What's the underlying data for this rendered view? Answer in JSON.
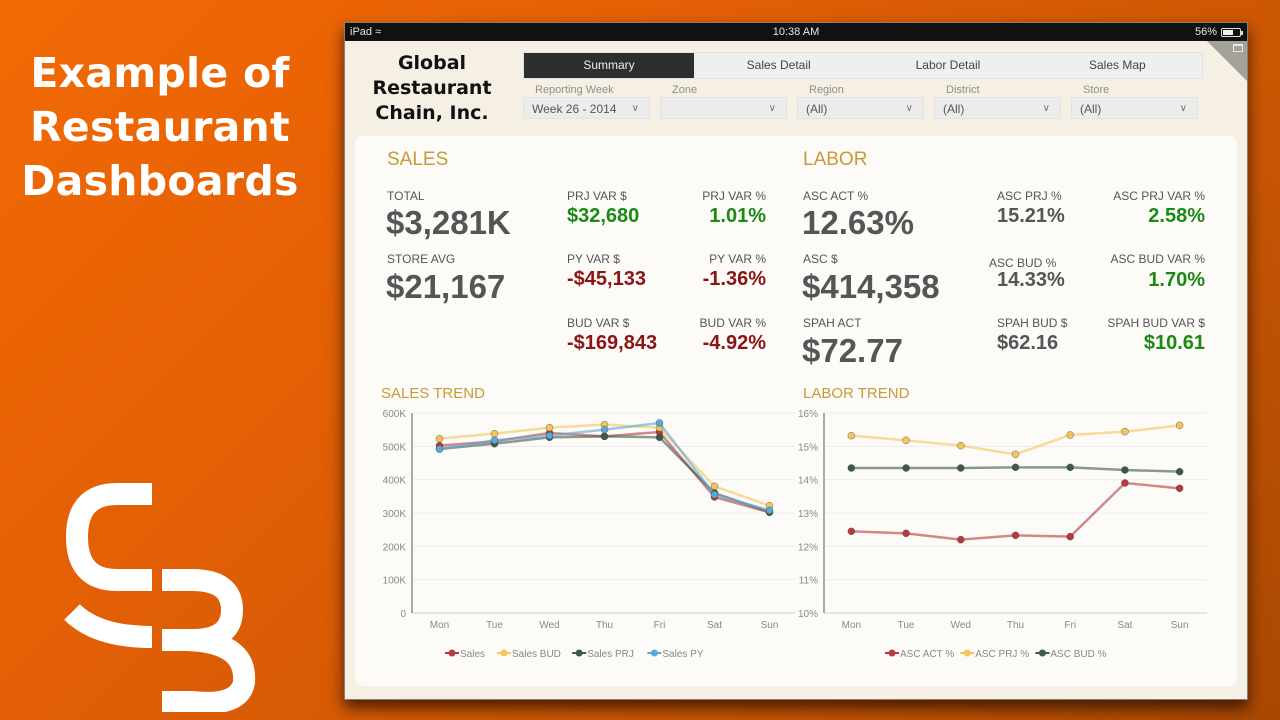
{
  "promo": {
    "title_lines": [
      "Example of",
      "Restaurant",
      "Dashboards"
    ],
    "logo": "sb-logo"
  },
  "statusbar": {
    "device": "iPad",
    "wifi_icon": "wifi-icon",
    "time": "10:38 AM",
    "battery": "56%",
    "battery_level": 0.56
  },
  "header": {
    "company_lines": [
      "Global",
      "Restaurant",
      "Chain, Inc."
    ],
    "tabs": [
      {
        "label": "Summary",
        "active": true
      },
      {
        "label": "Sales Detail",
        "active": false
      },
      {
        "label": "Labor Detail",
        "active": false
      },
      {
        "label": "Sales Map",
        "active": false
      }
    ],
    "filters": [
      {
        "label": "Reporting Week",
        "value": "Week 26 - 2014"
      },
      {
        "label": "Zone",
        "value": ""
      },
      {
        "label": "Region",
        "value": "(All)"
      },
      {
        "label": "District",
        "value": "(All)"
      },
      {
        "label": "Store",
        "value": "(All)"
      }
    ]
  },
  "sales": {
    "title": "SALES",
    "total": {
      "label": "TOTAL",
      "value": "$3,281K"
    },
    "store_avg": {
      "label": "STORE AVG",
      "value": "$21,167"
    },
    "prj_var_usd": {
      "label": "PRJ VAR $",
      "value": "$32,680"
    },
    "prj_var_pct": {
      "label": "PRJ VAR %",
      "value": "1.01%"
    },
    "py_var_usd": {
      "label": "PY VAR $",
      "value": "-$45,133"
    },
    "py_var_pct": {
      "label": "PY VAR %",
      "value": "-1.36%"
    },
    "bud_var_usd": {
      "label": "BUD VAR $",
      "value": "-$169,843"
    },
    "bud_var_pct": {
      "label": "BUD VAR %",
      "value": "-4.92%"
    }
  },
  "labor": {
    "title": "LABOR",
    "asc_act_pct": {
      "label": "ASC ACT %",
      "value": "12.63%"
    },
    "asc_usd": {
      "label": "ASC $",
      "value": "$414,358"
    },
    "spah_act": {
      "label": "SPAH ACT",
      "value": "$72.77"
    },
    "asc_prj_pct": {
      "label": "ASC PRJ %",
      "value": "15.21%"
    },
    "asc_bud_pct": {
      "label": "ASC BUD %",
      "value": "14.33%"
    },
    "spah_bud": {
      "label": "SPAH BUD $",
      "value": "$62.16"
    },
    "asc_prj_var_pct": {
      "label": "ASC PRJ VAR %",
      "value": "2.58%"
    },
    "asc_bud_var_pct": {
      "label": "ASC BUD VAR %",
      "value": "1.70%"
    },
    "spah_bud_var": {
      "label": "SPAH BUD VAR $",
      "value": "$10.61"
    }
  },
  "colors": {
    "accent": "#c99a3a",
    "positive": "#1b8a14",
    "negative": "#8b1414"
  },
  "chart_data": [
    {
      "type": "line",
      "title": "SALES TREND",
      "categories": [
        "Mon",
        "Tue",
        "Wed",
        "Thu",
        "Fri",
        "Sat",
        "Sun"
      ],
      "ylim": [
        0,
        600000
      ],
      "yticks": [
        0,
        100000,
        200000,
        300000,
        400000,
        500000,
        600000
      ],
      "ytick_labels": [
        "0",
        "100K",
        "200K",
        "300K",
        "400K",
        "500K",
        "600K"
      ],
      "grid": true,
      "legend": "bottom",
      "series": [
        {
          "name": "Sales",
          "color": "#b83a3a",
          "values": [
            502000,
            515000,
            540000,
            530000,
            543000,
            348000,
            302000
          ]
        },
        {
          "name": "Sales BUD",
          "color": "#f2c65a",
          "values": [
            523000,
            538000,
            556000,
            565000,
            556000,
            380000,
            322000
          ]
        },
        {
          "name": "Sales PRJ",
          "color": "#3d5a48",
          "values": [
            492000,
            508000,
            527000,
            530000,
            527000,
            360000,
            303000
          ]
        },
        {
          "name": "Sales PY",
          "color": "#5aa7d9",
          "values": [
            492000,
            518000,
            532000,
            550000,
            570000,
            355000,
            308000
          ]
        }
      ]
    },
    {
      "type": "line",
      "title": "LABOR TREND",
      "categories": [
        "Mon",
        "Tue",
        "Wed",
        "Thu",
        "Fri",
        "Sat",
        "Sun"
      ],
      "ylim": [
        10,
        16
      ],
      "yticks": [
        10,
        11,
        12,
        13,
        14,
        15,
        16
      ],
      "ytick_labels": [
        "10%",
        "11%",
        "12%",
        "13%",
        "14%",
        "15%",
        "16%"
      ],
      "grid": true,
      "legend": "bottom",
      "series": [
        {
          "name": "ASC ACT %",
          "color": "#b83a3a",
          "values": [
            12.45,
            12.39,
            12.2,
            12.33,
            12.29,
            13.9,
            13.74
          ]
        },
        {
          "name": "ASC PRJ %",
          "color": "#f2c65a",
          "values": [
            15.32,
            15.18,
            15.02,
            14.76,
            15.34,
            15.44,
            15.63
          ]
        },
        {
          "name": "ASC BUD %",
          "color": "#3d5a48",
          "values": [
            14.35,
            14.35,
            14.35,
            14.37,
            14.37,
            14.29,
            14.24
          ]
        }
      ]
    }
  ]
}
